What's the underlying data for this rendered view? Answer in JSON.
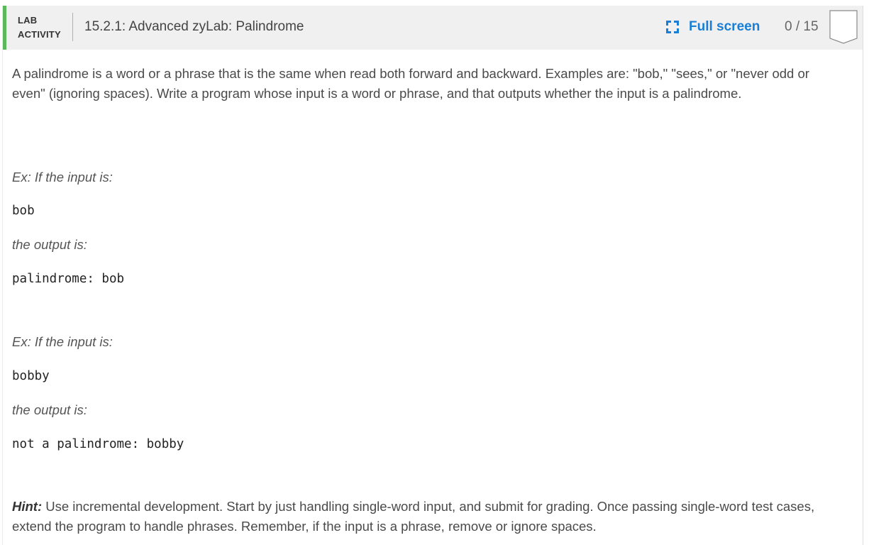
{
  "header": {
    "lab_line1": "LAB",
    "lab_line2": "ACTIVITY",
    "title": "15.2.1: Advanced zyLab: Palindrome",
    "fullscreen_label": "Full screen",
    "fullscreen_icon": "expand-icon",
    "score": "0 / 15",
    "accent_color": "#5cb85c",
    "link_color": "#1a7fd4"
  },
  "content": {
    "intro": "A palindrome is a word or a phrase that is the same when read both forward and backward. Examples are: \"bob,\" \"sees,\" or \"never odd or even\" (ignoring spaces). Write a program whose input is a word or phrase, and that outputs whether the input is a palindrome.",
    "examples": [
      {
        "input_label": "Ex: If the input is:",
        "input": "bob",
        "output_label": "the output is:",
        "output": "palindrome: bob"
      },
      {
        "input_label": "Ex: If the input is:",
        "input": "bobby",
        "output_label": "the output is:",
        "output": "not a palindrome: bobby"
      }
    ],
    "hint_label": "Hint:",
    "hint_text": " Use incremental development. Start by just handling single-word input, and submit for grading. Once passing single-word test cases, extend the program to handle phrases. Remember, if the input is a phrase,  remove or ignore spaces."
  }
}
